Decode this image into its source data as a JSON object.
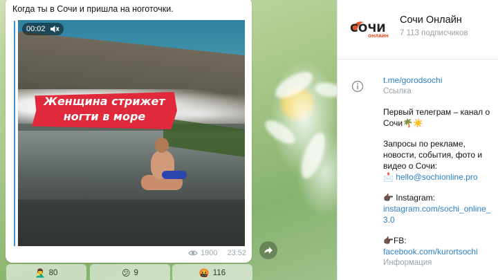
{
  "message": {
    "caption": "Когда ты в Сочи и пришла на ноготочки.",
    "video": {
      "timer": "00:02",
      "banner_line_1": "Женщина стрижет",
      "banner_line_2": "ногти в море"
    },
    "views": "1900",
    "time": "23:52"
  },
  "reactions": [
    {
      "emoji": "🤦‍♂️",
      "count": "80"
    },
    {
      "emoji": "😕",
      "count": "9"
    },
    {
      "emoji": "🤬",
      "count": "116"
    }
  ],
  "channel": {
    "logo_text": "СОЧИ",
    "logo_subtext": "ОНЛАЙН",
    "title": "Сочи Онлайн",
    "subscribers": "7 113 подписчиков",
    "link": "t.me/gorodsochi",
    "link_label": "Ссылка",
    "desc_1": "Первый телеграм – канал о Сочи🌴☀️",
    "desc_2": "Запросы по рекламе, новости, события, фото и видео о Сочи:",
    "email_icon": "📩",
    "email": "hello@sochionline.pro",
    "instagram_label": "👉🏿 Instagram:",
    "instagram_link": "instagram.com/sochi_online_3.0",
    "fb_label": "👉🏿FB:",
    "fb_link": "facebook.com/kurortsochi",
    "info_label": "Информация"
  },
  "colors": {
    "accent": "#2a7fc3",
    "banner": "#e02a3b",
    "logo_orange": "#e2522b"
  }
}
